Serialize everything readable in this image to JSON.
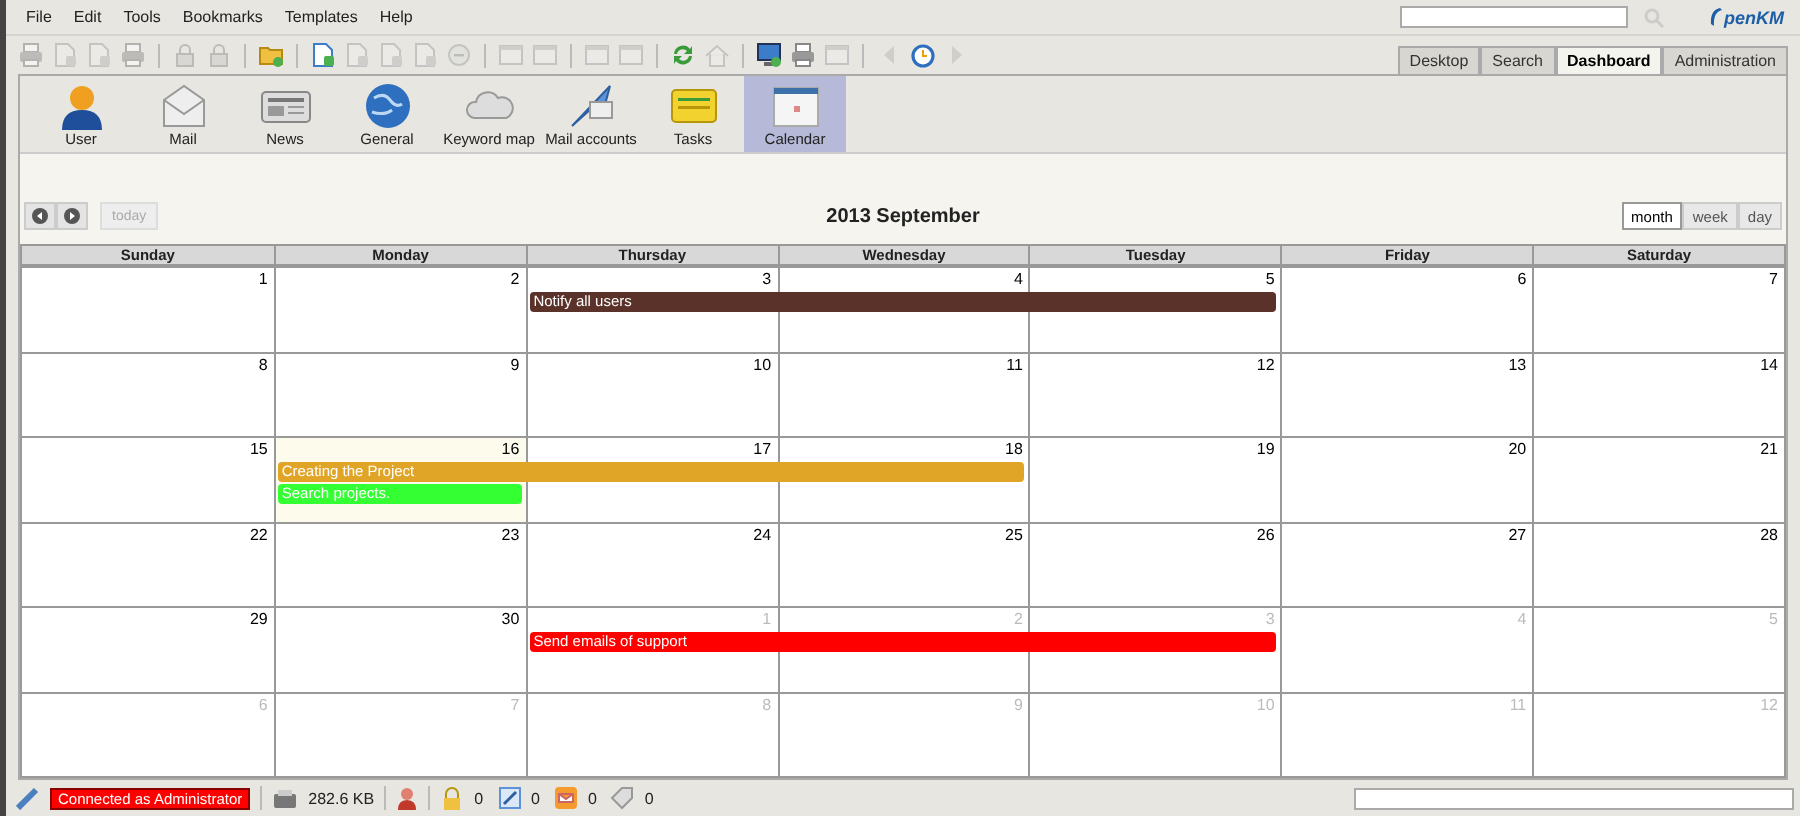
{
  "menu": [
    "File",
    "Edit",
    "Tools",
    "Bookmarks",
    "Templates",
    "Help"
  ],
  "toolbar": [
    {
      "kind": "printer",
      "disabled": true
    },
    {
      "kind": "document",
      "disabled": true
    },
    {
      "kind": "document",
      "disabled": true
    },
    {
      "kind": "printer",
      "disabled": true
    },
    {
      "kind": "separator"
    },
    {
      "kind": "lock",
      "disabled": true
    },
    {
      "kind": "lock",
      "disabled": true
    },
    {
      "kind": "separator"
    },
    {
      "kind": "folder",
      "disabled": false
    },
    {
      "kind": "separator"
    },
    {
      "kind": "document",
      "disabled": false
    },
    {
      "kind": "document",
      "disabled": true
    },
    {
      "kind": "document",
      "disabled": true
    },
    {
      "kind": "document",
      "disabled": true
    },
    {
      "kind": "circle",
      "disabled": true
    },
    {
      "kind": "separator"
    },
    {
      "kind": "window",
      "disabled": true
    },
    {
      "kind": "window",
      "disabled": true
    },
    {
      "kind": "separator"
    },
    {
      "kind": "window",
      "disabled": true
    },
    {
      "kind": "window",
      "disabled": true
    },
    {
      "kind": "separator"
    },
    {
      "kind": "refresh",
      "disabled": false
    },
    {
      "kind": "home",
      "disabled": true
    },
    {
      "kind": "separator"
    },
    {
      "kind": "monitor",
      "disabled": false
    },
    {
      "kind": "printer",
      "disabled": false
    },
    {
      "kind": "window",
      "disabled": true
    },
    {
      "kind": "separator"
    },
    {
      "kind": "back",
      "disabled": true
    },
    {
      "kind": "clock",
      "disabled": false
    },
    {
      "kind": "forward",
      "disabled": true
    }
  ],
  "logo": "penKM",
  "workspace_tabs": [
    {
      "label": "Desktop",
      "selected": false
    },
    {
      "label": "Search",
      "selected": false
    },
    {
      "label": "Dashboard",
      "selected": true
    },
    {
      "label": "Administration",
      "selected": false
    }
  ],
  "dashboard_tabs": [
    {
      "label": "User",
      "kind": "user",
      "selected": false
    },
    {
      "label": "Mail",
      "kind": "mail",
      "selected": false
    },
    {
      "label": "News",
      "kind": "news",
      "selected": false
    },
    {
      "label": "General",
      "kind": "globe",
      "selected": false
    },
    {
      "label": "Keyword map",
      "kind": "cloud",
      "selected": false
    },
    {
      "label": "Mail accounts",
      "kind": "send",
      "selected": false
    },
    {
      "label": "Tasks",
      "kind": "notes",
      "selected": false
    },
    {
      "label": "Calendar",
      "kind": "calendar",
      "selected": true
    }
  ],
  "calendar": {
    "today_button": {
      "label": "today",
      "disabled": true
    },
    "title": "2013 September",
    "views": [
      {
        "label": "month",
        "selected": true
      },
      {
        "label": "week",
        "selected": false
      },
      {
        "label": "day",
        "selected": false
      }
    ],
    "weekdays": [
      "Sunday",
      "Monday",
      "Thursday",
      "Wednesday",
      "Tuesday",
      "Friday",
      "Saturday"
    ],
    "weeks": [
      {
        "days": [
          {
            "number": "1",
            "other_month": false
          },
          {
            "number": "2",
            "other_month": false
          },
          {
            "number": "3",
            "other_month": false,
            "bars": [
              {
                "kind": "start",
                "title": "Notify all users",
                "color": "#5a3229"
              }
            ]
          },
          {
            "number": "4",
            "other_month": false,
            "bars": [
              {
                "kind": "continuation"
              }
            ]
          },
          {
            "number": "5",
            "other_month": false,
            "bars": [
              {
                "kind": "continuation"
              }
            ]
          },
          {
            "number": "6",
            "other_month": false
          },
          {
            "number": "7",
            "other_month": false
          }
        ]
      },
      {
        "days": [
          {
            "number": "8",
            "other_month": false
          },
          {
            "number": "9",
            "other_month": false
          },
          {
            "number": "10",
            "other_month": false
          },
          {
            "number": "11",
            "other_month": false
          },
          {
            "number": "12",
            "other_month": false
          },
          {
            "number": "13",
            "other_month": false
          },
          {
            "number": "14",
            "other_month": false
          }
        ]
      },
      {
        "days": [
          {
            "number": "15",
            "other_month": false
          },
          {
            "number": "16",
            "other_month": false,
            "today": true,
            "bars": [
              {
                "kind": "start",
                "title": "Creating the Project",
                "color": "#e0a526"
              },
              {
                "kind": "start",
                "title": "Search projects.",
                "color": "#33ff33"
              }
            ]
          },
          {
            "number": "17",
            "other_month": false,
            "bars": [
              {
                "kind": "continuation"
              }
            ]
          },
          {
            "number": "18",
            "other_month": false,
            "bars": [
              {
                "kind": "continuation"
              }
            ]
          },
          {
            "number": "19",
            "other_month": false
          },
          {
            "number": "20",
            "other_month": false
          },
          {
            "number": "21",
            "other_month": false
          }
        ]
      },
      {
        "days": [
          {
            "number": "22",
            "other_month": false
          },
          {
            "number": "23",
            "other_month": false
          },
          {
            "number": "24",
            "other_month": false
          },
          {
            "number": "25",
            "other_month": false
          },
          {
            "number": "26",
            "other_month": false
          },
          {
            "number": "27",
            "other_month": false
          },
          {
            "number": "28",
            "other_month": false
          }
        ]
      },
      {
        "days": [
          {
            "number": "29",
            "other_month": false
          },
          {
            "number": "30",
            "other_month": false
          },
          {
            "number": "1",
            "other_month": true,
            "bars": [
              {
                "kind": "start",
                "title": "Send emails of support",
                "color": "#ff0000"
              }
            ]
          },
          {
            "number": "2",
            "other_month": true,
            "bars": [
              {
                "kind": "continuation"
              }
            ]
          },
          {
            "number": "3",
            "other_month": true,
            "bars": [
              {
                "kind": "continuation"
              }
            ]
          },
          {
            "number": "4",
            "other_month": true
          },
          {
            "number": "5",
            "other_month": true
          }
        ]
      },
      {
        "days": [
          {
            "number": "6",
            "other_month": true
          },
          {
            "number": "7",
            "other_month": true
          },
          {
            "number": "8",
            "other_month": true
          },
          {
            "number": "9",
            "other_month": true
          },
          {
            "number": "10",
            "other_month": true
          },
          {
            "number": "11",
            "other_month": true
          },
          {
            "number": "12",
            "other_month": true
          }
        ]
      }
    ]
  },
  "status_bar": {
    "user": "Connected as Administrator",
    "size": "282.6 KB",
    "counters": [
      {
        "kind": "lock",
        "count": "0"
      },
      {
        "kind": "edit",
        "count": "0"
      },
      {
        "kind": "mail",
        "count": "0"
      },
      {
        "kind": "tag",
        "count": "0"
      }
    ]
  }
}
